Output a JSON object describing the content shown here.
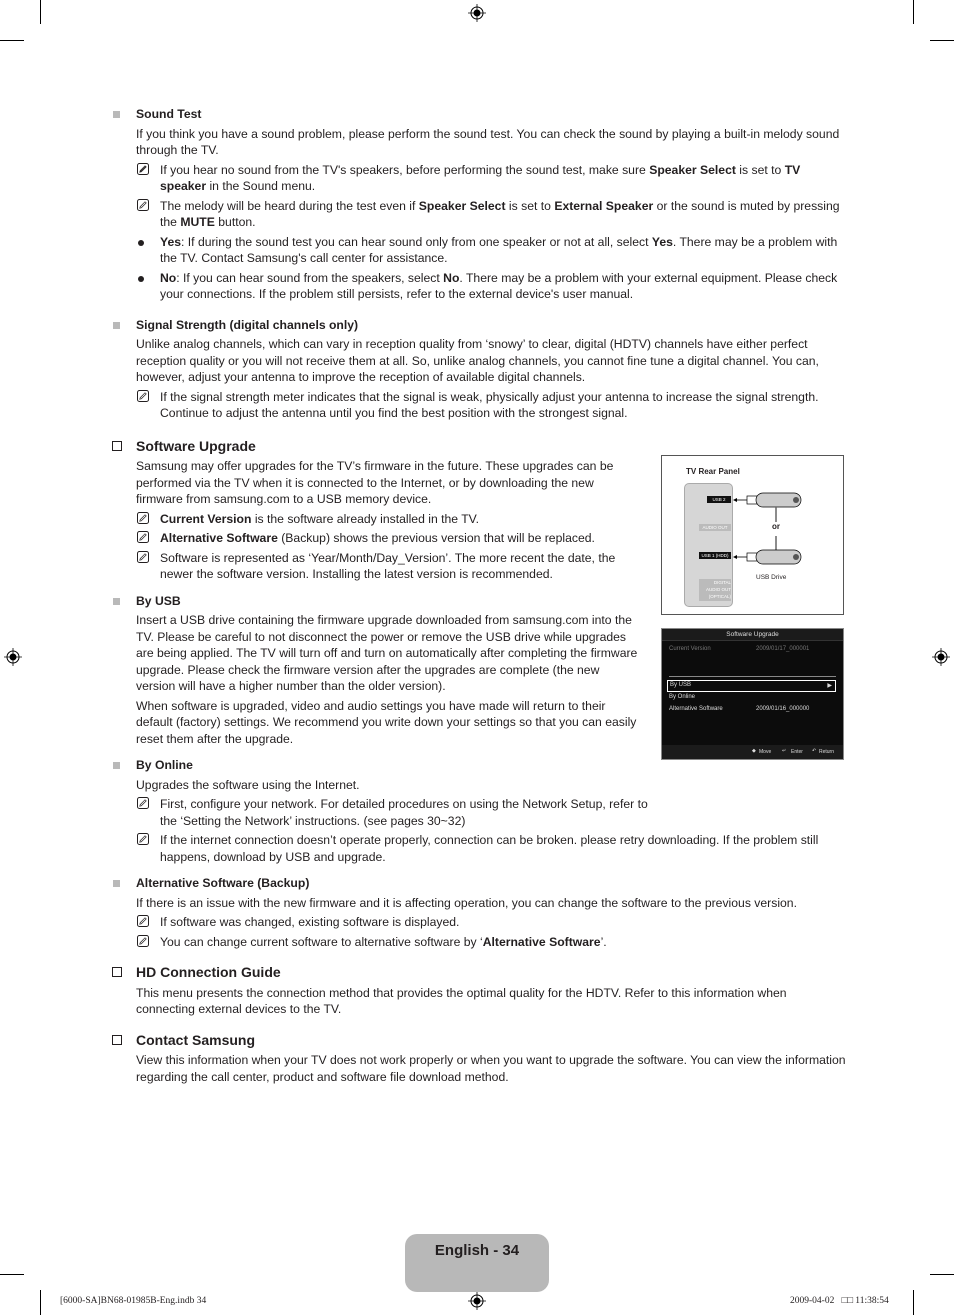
{
  "sections": {
    "sound_test": {
      "title": "Sound Test",
      "intro": "If you think you have a sound problem, please perform the sound test. You can check the sound by playing a built-in melody sound through the TV.",
      "notes": [
        [
          "If you hear no sound from the TV's speakers, before performing the sound test, make sure ",
          "Speaker Select",
          " is set to ",
          "TV speaker",
          " in the Sound menu."
        ],
        [
          "The melody will be heard during the test even if ",
          "Speaker Select",
          " is set to ",
          "External Speaker",
          " or the sound is muted by pressing the ",
          "MUTE",
          " button."
        ]
      ],
      "bullets": [
        [
          "Yes",
          ": If during the sound test you can hear sound only from one speaker or not at all, select ",
          "Yes",
          ". There may be a problem with the TV. Contact Samsung's call center for assistance."
        ],
        [
          "No",
          ": If you can hear sound from the speakers, select ",
          "No",
          ". There may be a problem with your external equipment. Please check your connections. If the problem still persists, refer to the external device's user manual."
        ]
      ]
    },
    "signal_strength": {
      "title": "Signal Strength (digital channels only)",
      "intro": "Unlike analog channels, which can vary in reception quality from ‘snowy’ to clear, digital (HDTV) channels have either perfect reception quality or you will not receive them at all. So, unlike analog channels, you cannot fine tune a digital channel. You can, however, adjust your antenna to improve the reception of available digital channels.",
      "note": "If the signal strength meter indicates that the signal is weak, physically adjust your antenna to increase the signal strength. Continue to adjust the antenna until you find the best position with the strongest signal."
    },
    "software_upgrade": {
      "title": "Software Upgrade",
      "intro": "Samsung may offer upgrades for the TV’s firmware in the future. These upgrades can be performed via the TV when it is connected to the Internet, or by downloading the new firmware from samsung.com to a USB memory device.",
      "notes": [
        [
          "Current Version",
          " is the software already installed in the TV."
        ],
        [
          "Alternative Software",
          " (Backup) shows the previous version that will be replaced."
        ],
        [
          "",
          "Software is represented as ‘Year/Month/Day_Version’. The more recent the date, the newer the software version. Installing the latest version is recommended."
        ]
      ],
      "by_usb": {
        "title": "By USB",
        "p1": "Insert a USB drive containing the firmware upgrade downloaded from samsung.com into the TV. Please be careful to not disconnect the power or remove the USB drive while upgrades are being applied. The TV will turn off and turn on automatically after completing the firmware upgrade. Please check the firmware version after the upgrades are complete (the new version will have a higher number than the older version).",
        "p2": "When software is upgraded, video and audio settings you have made will return to their default (factory) settings. We recommend you write down your settings so that you can easily reset them after the upgrade."
      },
      "by_online": {
        "title": "By Online",
        "intro": "Upgrades the software using the Internet.",
        "notes": [
          "First, configure your network.  For detailed procedures on using the Network Setup, refer to the ‘Setting the Network’ instructions. (see pages 30~32)",
          "If the internet connection doesn’t operate properly, connection can be broken. please retry downloading. If the problem still happens, download by USB and upgrade."
        ]
      },
      "alt_software": {
        "title": "Alternative Software (Backup)",
        "intro": "If there is an issue with the new firmware and it is affecting operation, you can change the software to the previous version.",
        "note1": "If software was changed, existing software is displayed.",
        "note2": [
          "You can change current software to alternative software by ‘",
          "Alternative Software",
          "’."
        ]
      }
    },
    "hd_guide": {
      "title": "HD Connection Guide",
      "text": "This menu presents the connection method that provides the optimal quality for the HDTV. Refer to this information when connecting external devices to the TV."
    },
    "contact": {
      "title": "Contact Samsung",
      "text": "View this information when your TV does not work properly or when you want to upgrade the software. You can view the information regarding the call center, product and software file download method."
    }
  },
  "figure_rear_panel": {
    "title": "TV Rear Panel",
    "ports": [
      "USB 2",
      "AUDIO OUT",
      "USB 1 (HDD)",
      "DIGITAL AUDIO OUT (OPTICAL)"
    ],
    "or_label": "or",
    "drive_label": "USB Drive"
  },
  "figure_osd": {
    "title": "Software Upgrade",
    "current_label": "Current Version",
    "current_value": "2009/01/17_000001",
    "items": [
      "By USB",
      "By Online",
      "Alternative Software"
    ],
    "alt_value": "2009/01/16_000000",
    "footer": [
      "Move",
      "Enter",
      "Return"
    ]
  },
  "page_label": "English - 34",
  "footer_left": "[6000-SA]BN68-01985B-Eng.indb   34",
  "footer_right": "2009-04-02   □□ 11:38:54"
}
